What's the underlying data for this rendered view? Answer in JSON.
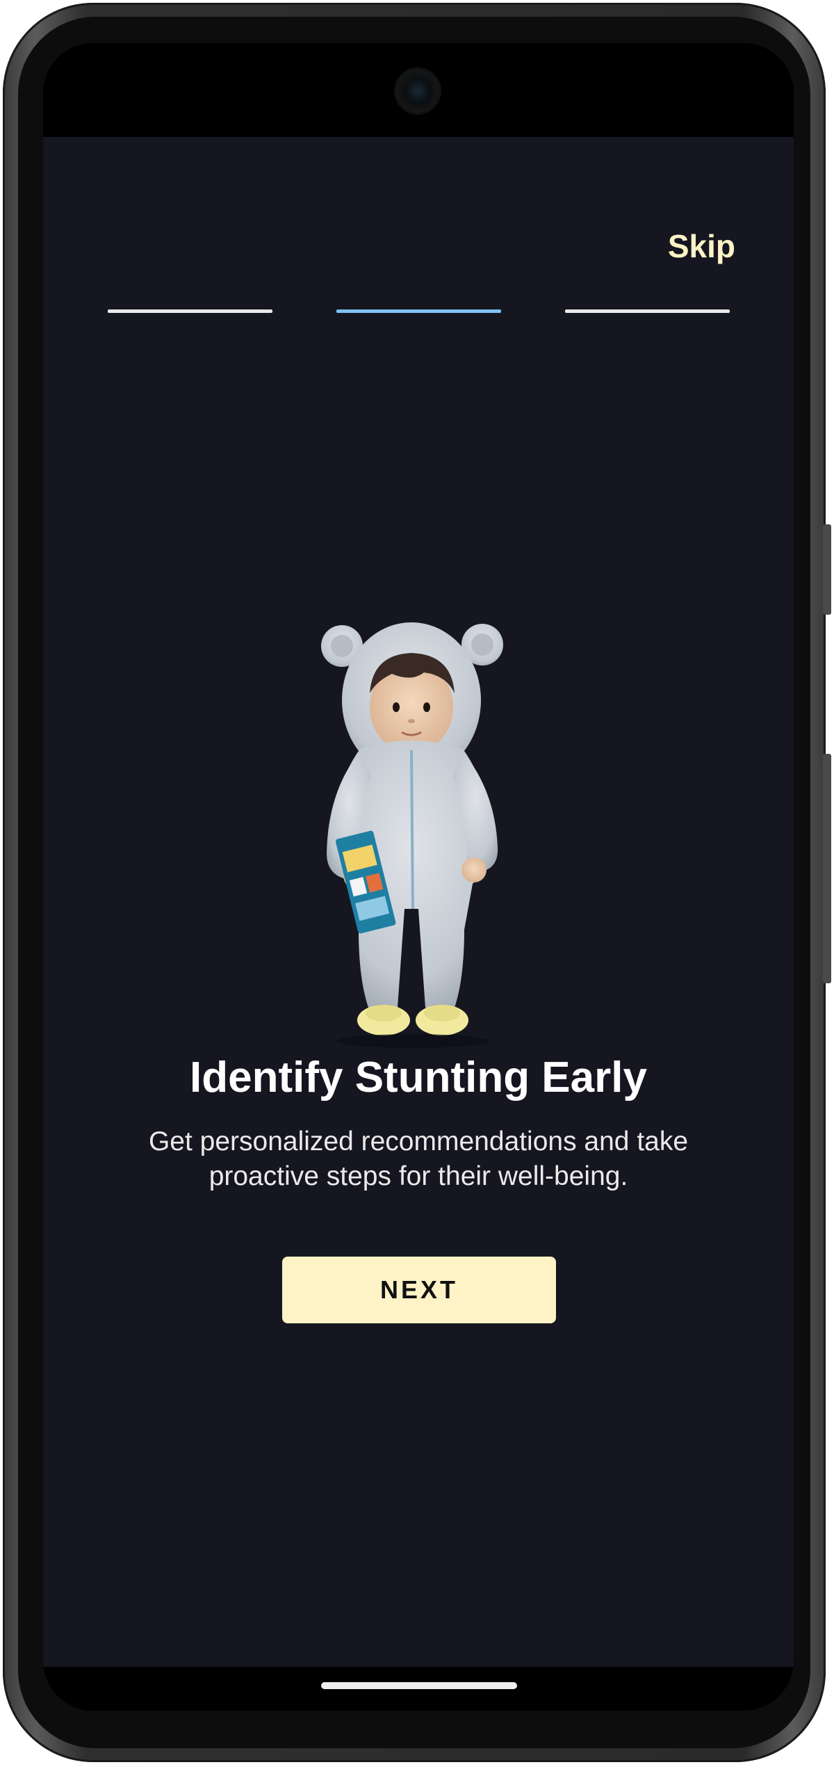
{
  "onboarding": {
    "skip_label": "Skip",
    "steps": [
      {
        "state": "inactive",
        "color": "#e8e8e8"
      },
      {
        "state": "active",
        "color": "#7ec3f2"
      },
      {
        "state": "inactive",
        "color": "#e8e8e8"
      }
    ],
    "current_step": 2,
    "total_steps": 3,
    "illustration": "toddler-in-bear-onesie-holding-book",
    "title": "Identify Stunting Early",
    "subtitle": "Get personalized recommendations and take proactive steps for their well-being.",
    "next_label": "NEXT"
  },
  "colors": {
    "background": "#161621",
    "accent": "#fdf3c6",
    "active_step": "#7ec3f2"
  }
}
